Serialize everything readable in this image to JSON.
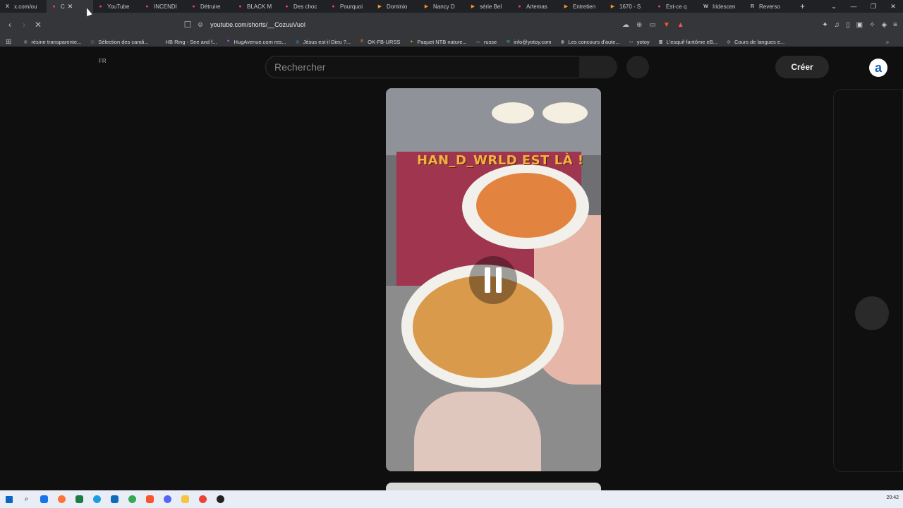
{
  "tabs": [
    {
      "label": "x.com/ou",
      "icon": "x-icon",
      "color": "#ffffff",
      "active": false
    },
    {
      "label": "C",
      "icon": "youtube-icon",
      "color": "#ff3b5c",
      "active": true
    },
    {
      "label": "YouTube",
      "icon": "youtube-icon",
      "color": "#ff3b5c",
      "active": false
    },
    {
      "label": "INCENDI",
      "icon": "youtube-icon",
      "color": "#ff3b5c",
      "active": false
    },
    {
      "label": "Détruire",
      "icon": "youtube-icon",
      "color": "#ff3b5c",
      "active": false
    },
    {
      "label": "BLACK M",
      "icon": "youtube-icon",
      "color": "#ff3b5c",
      "active": false
    },
    {
      "label": "Des choc",
      "icon": "youtube-icon",
      "color": "#ff3b5c",
      "active": false
    },
    {
      "label": "Pourquoi",
      "icon": "youtube-icon",
      "color": "#ff3b5c",
      "active": false
    },
    {
      "label": "Dominio",
      "icon": "play-icon",
      "color": "#f29727",
      "active": false
    },
    {
      "label": "Nancy D",
      "icon": "play-icon",
      "color": "#f29727",
      "active": false
    },
    {
      "label": "série Bel",
      "icon": "play-icon",
      "color": "#f29727",
      "active": false
    },
    {
      "label": "Artemas",
      "icon": "youtube-icon",
      "color": "#ff3b5c",
      "active": false
    },
    {
      "label": "Entretien",
      "icon": "play-icon",
      "color": "#f29727",
      "active": false
    },
    {
      "label": "1670 - S",
      "icon": "play-icon",
      "color": "#f29727",
      "active": false
    },
    {
      "label": "Est-ce q",
      "icon": "youtube-icon",
      "color": "#ff3b5c",
      "active": false
    },
    {
      "label": "Iridescen",
      "icon": "wikipedia-icon",
      "color": "#ffffff",
      "active": false
    },
    {
      "label": "Reverso",
      "icon": "reverso-icon",
      "color": "#ffffff",
      "active": false
    }
  ],
  "address": {
    "url": "youtube.com/shorts/__CozuuVuol"
  },
  "bookmarks": [
    {
      "label": "résine transparente...",
      "icon": "globe-icon",
      "color": "#9aa0a6"
    },
    {
      "label": "Sélection des candi...",
      "icon": "page-icon",
      "color": "#666666"
    },
    {
      "label": "HB Ring - See and f...",
      "icon": "t-icon",
      "color": "#333333"
    },
    {
      "label": "HugAvenue.com res...",
      "icon": "heart-icon",
      "color": "#c34fd1"
    },
    {
      "label": "Jésus est-il Dieu ?...",
      "icon": "globe-icon",
      "color": "#3d7bd9"
    },
    {
      "label": "OK-FB-URSS",
      "icon": "ok-icon",
      "color": "#f58220"
    },
    {
      "label": "Paquet NTB nature...",
      "icon": "leaf-icon",
      "color": "#c9a227"
    },
    {
      "label": "russe",
      "icon": "folder-icon",
      "color": "#9aa0a6"
    },
    {
      "label": "info@yotoy.com",
      "icon": "mail-icon",
      "color": "#4bb38a"
    },
    {
      "label": "Les concours d'aute...",
      "icon": "globe-icon",
      "color": "#dddddd"
    },
    {
      "label": "yotoy",
      "icon": "folder-icon",
      "color": "#9aa0a6"
    },
    {
      "label": "L'esquif fantôme eB...",
      "icon": "book-icon",
      "color": "#ffffff"
    },
    {
      "label": "Cours de langues e...",
      "icon": "globe-icon",
      "color": "#9aa0a6"
    }
  ],
  "page": {
    "lang": "FR",
    "search_placeholder": "Rechercher",
    "create_label": "Créer",
    "avatar_letter": "a"
  },
  "video": {
    "overlay_text": "HAN_D_WRLD EST LÀ !",
    "state": "paused"
  },
  "taskbar": {
    "clock": "20:42"
  }
}
